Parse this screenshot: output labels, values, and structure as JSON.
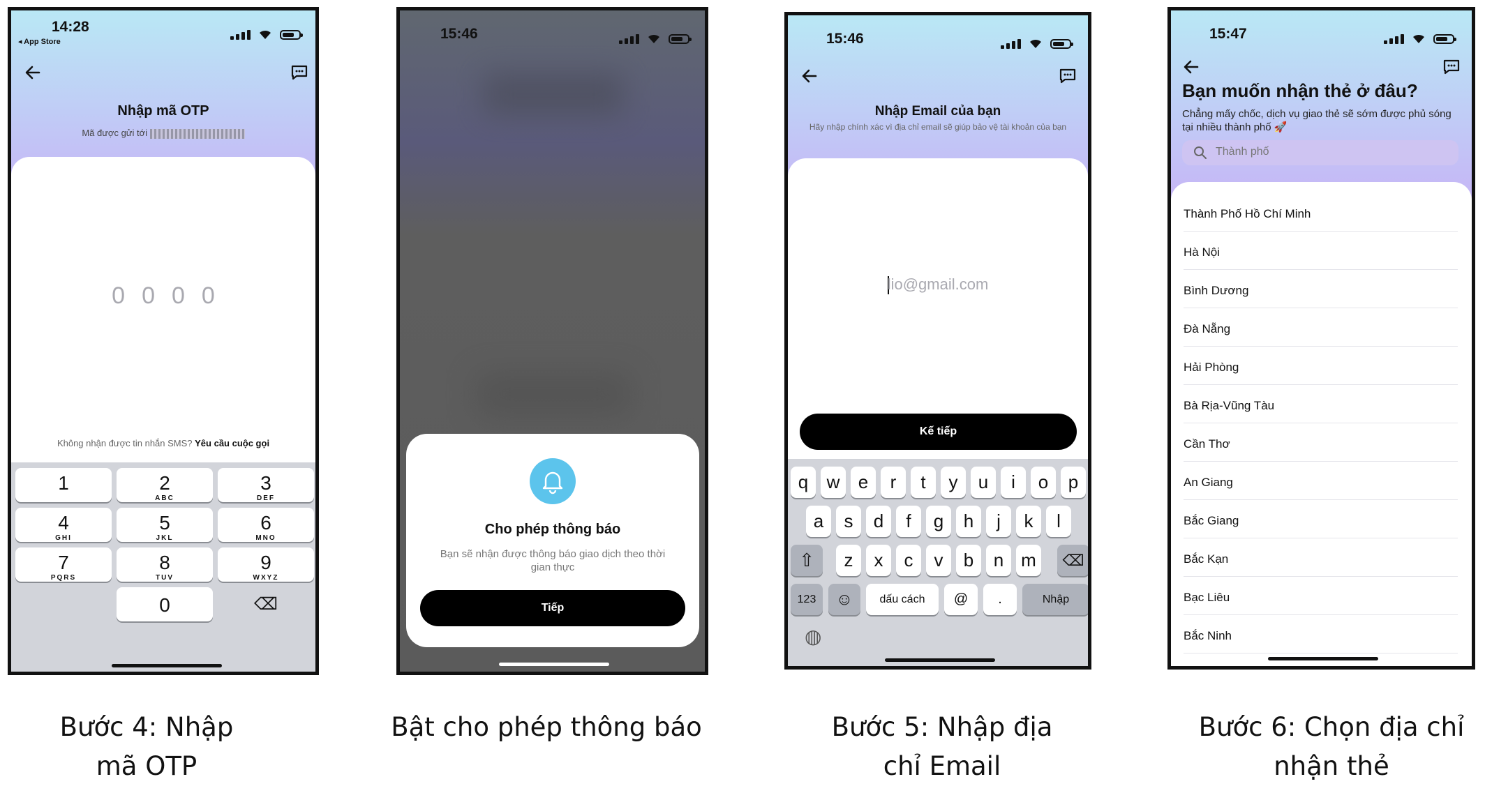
{
  "screens": {
    "otp": {
      "time": "14:28",
      "back_app": "◂ App Store",
      "title": "Nhập mã OTP",
      "subtitle_prefix": "Mã được gửi tới",
      "otp_digits": [
        "0",
        "0",
        "0",
        "0"
      ],
      "no_sms": "Không nhận được tin nhắn SMS?",
      "request_call": "Yêu cầu cuộc gọi",
      "keypad": [
        {
          "d": "1",
          "l": ""
        },
        {
          "d": "2",
          "l": "ABC"
        },
        {
          "d": "3",
          "l": "DEF"
        },
        {
          "d": "4",
          "l": "GHI"
        },
        {
          "d": "5",
          "l": "JKL"
        },
        {
          "d": "6",
          "l": "MNO"
        },
        {
          "d": "7",
          "l": "PQRS"
        },
        {
          "d": "8",
          "l": "TUV"
        },
        {
          "d": "9",
          "l": "WXYZ"
        },
        {
          "d": "0",
          "l": ""
        }
      ],
      "delete_glyph": "⌫"
    },
    "notify": {
      "time": "15:46",
      "title": "Cho phép thông báo",
      "desc": "Bạn sẽ nhận được thông báo giao dịch theo thời gian thực",
      "button": "Tiếp"
    },
    "email": {
      "time": "15:46",
      "title": "Nhập Email của bạn",
      "subtitle": "Hãy nhập chính xác vì địa chỉ email sẽ giúp bảo vệ tài khoản của bạn",
      "placeholder": "lio@gmail.com",
      "button": "Kế tiếp",
      "row1": [
        "q",
        "w",
        "e",
        "r",
        "t",
        "y",
        "u",
        "i",
        "o",
        "p"
      ],
      "row2": [
        "a",
        "s",
        "d",
        "f",
        "g",
        "h",
        "j",
        "k",
        "l"
      ],
      "row3": [
        "z",
        "x",
        "c",
        "v",
        "b",
        "n",
        "m"
      ],
      "shift": "⇧",
      "backspace": "⌫",
      "num_key": "123",
      "emoji_key": "☺",
      "space_key": "dấu cách",
      "at_key": "@",
      "dot_key": ".",
      "enter_key": "Nhập",
      "globe": "◍"
    },
    "city": {
      "time": "15:47",
      "title": "Bạn muốn nhận thẻ ở đâu?",
      "subtitle": "Chẳng mấy chốc, dịch vụ giao thẻ sẽ sớm được phủ sóng tại nhiều thành phố 🚀",
      "search_placeholder": "Thành phố",
      "cities": [
        "Thành Phố Hồ Chí Minh",
        "Hà Nội",
        "Bình Dương",
        "Đà Nẵng",
        "Hải Phòng",
        "Bà Rịa-Vũng Tàu",
        "Cần Thơ",
        "An Giang",
        "Bắc Giang",
        "Bắc Kạn",
        "Bạc Liêu",
        "Bắc Ninh"
      ]
    }
  },
  "captions": {
    "c1": "Bước 4: Nhập mã OTP",
    "c2": "Bật cho phép thông báo",
    "c3": "Bước 5: Nhập địa chỉ Email",
    "c4": "Bước 6: Chọn địa chỉ nhận thẻ"
  },
  "icons": {
    "back": "arrow-left-icon",
    "chat": "chat-icon",
    "bell": "bell-icon",
    "search": "search-icon"
  },
  "colors": {
    "gradient_top": "#b9e8f5",
    "gradient_bottom": "#c6b6f6",
    "keyboard_bg": "#d2d4da",
    "bell_circle": "#5cc4ec"
  }
}
